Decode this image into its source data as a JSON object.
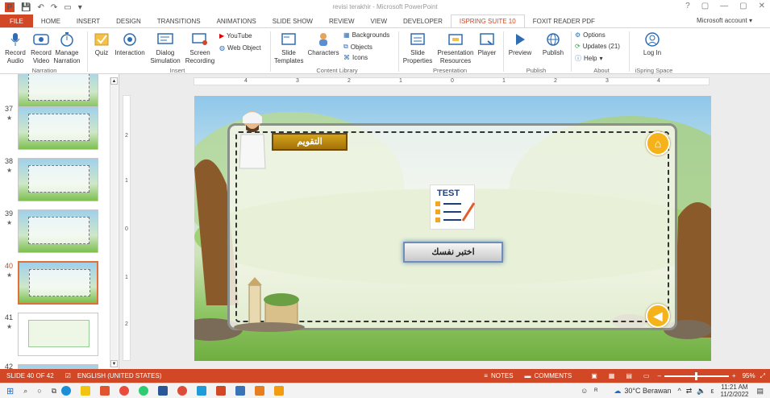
{
  "window": {
    "title": "revisi terakhir - Microsoft PowerPoint",
    "controls": [
      "?",
      "▢",
      "—",
      "▢",
      "✕"
    ]
  },
  "tabs": [
    "FILE",
    "HOME",
    "INSERT",
    "DESIGN",
    "TRANSITIONS",
    "ANIMATIONS",
    "SLIDE SHOW",
    "REVIEW",
    "VIEW",
    "DEVELOPER",
    "ISPRING SUITE 10",
    "FOXIT READER PDF"
  ],
  "account": "Microsoft account",
  "ribbon": {
    "narration": {
      "record_audio": "Record Audio",
      "record_video": "Record Video",
      "manage_narration": "Manage Narration",
      "group": "Narration"
    },
    "insert": {
      "quiz": "Quiz",
      "interaction": "Interaction",
      "dialog_simulation": "Dialog Simulation",
      "screen_recording": "Screen Recording",
      "youtube": "YouTube",
      "web_object": "Web Object",
      "group": "Insert"
    },
    "content_library": {
      "slide_templates": "Slide Templates",
      "characters": "Characters",
      "backgrounds": "Backgrounds",
      "objects": "Objects",
      "icons": "Icons",
      "group": "Content Library"
    },
    "presentation": {
      "slide_properties": "Slide Properties",
      "presentation_resources": "Presentation Resources",
      "player": "Player",
      "group": "Presentation"
    },
    "publish": {
      "preview": "Preview",
      "publish": "Publish",
      "group": "Publish"
    },
    "about": {
      "options": "Options",
      "updates": "Updates (21)",
      "help": "Help",
      "group": "About"
    },
    "ispring_space": {
      "log_in": "Log In",
      "group": "iSpring Space"
    }
  },
  "thumbnails": [
    {
      "num": "37",
      "star": "★"
    },
    {
      "num": "38",
      "star": "★"
    },
    {
      "num": "39",
      "star": "★"
    },
    {
      "num": "40",
      "star": "★"
    },
    {
      "num": "41",
      "star": "★"
    },
    {
      "num": "42",
      "star": ""
    }
  ],
  "ruler": {
    "h": [
      "4",
      "3",
      "2",
      "1",
      "0",
      "1",
      "2",
      "3",
      "4"
    ],
    "v": [
      "2",
      "1",
      "0",
      "1",
      "2"
    ]
  },
  "slide": {
    "title": "التقويم",
    "test_label": "TEST",
    "test_button": "اختبر نفسك",
    "home_icon": "home-icon",
    "back_icon": "arrow-left-icon"
  },
  "status": {
    "slide": "SLIDE 40 OF 42",
    "language": "ENGLISH (UNITED STATES)",
    "notes": "NOTES",
    "comments": "COMMENTS",
    "zoom": "95%"
  },
  "taskbar": {
    "weather": "30°C Berawan",
    "time": "11:21 AM",
    "date": "11/2/2022",
    "input": "ε"
  },
  "colors": {
    "accent": "#d24726",
    "board_border": "#8a8f8a",
    "gold": "#d3a21b"
  }
}
